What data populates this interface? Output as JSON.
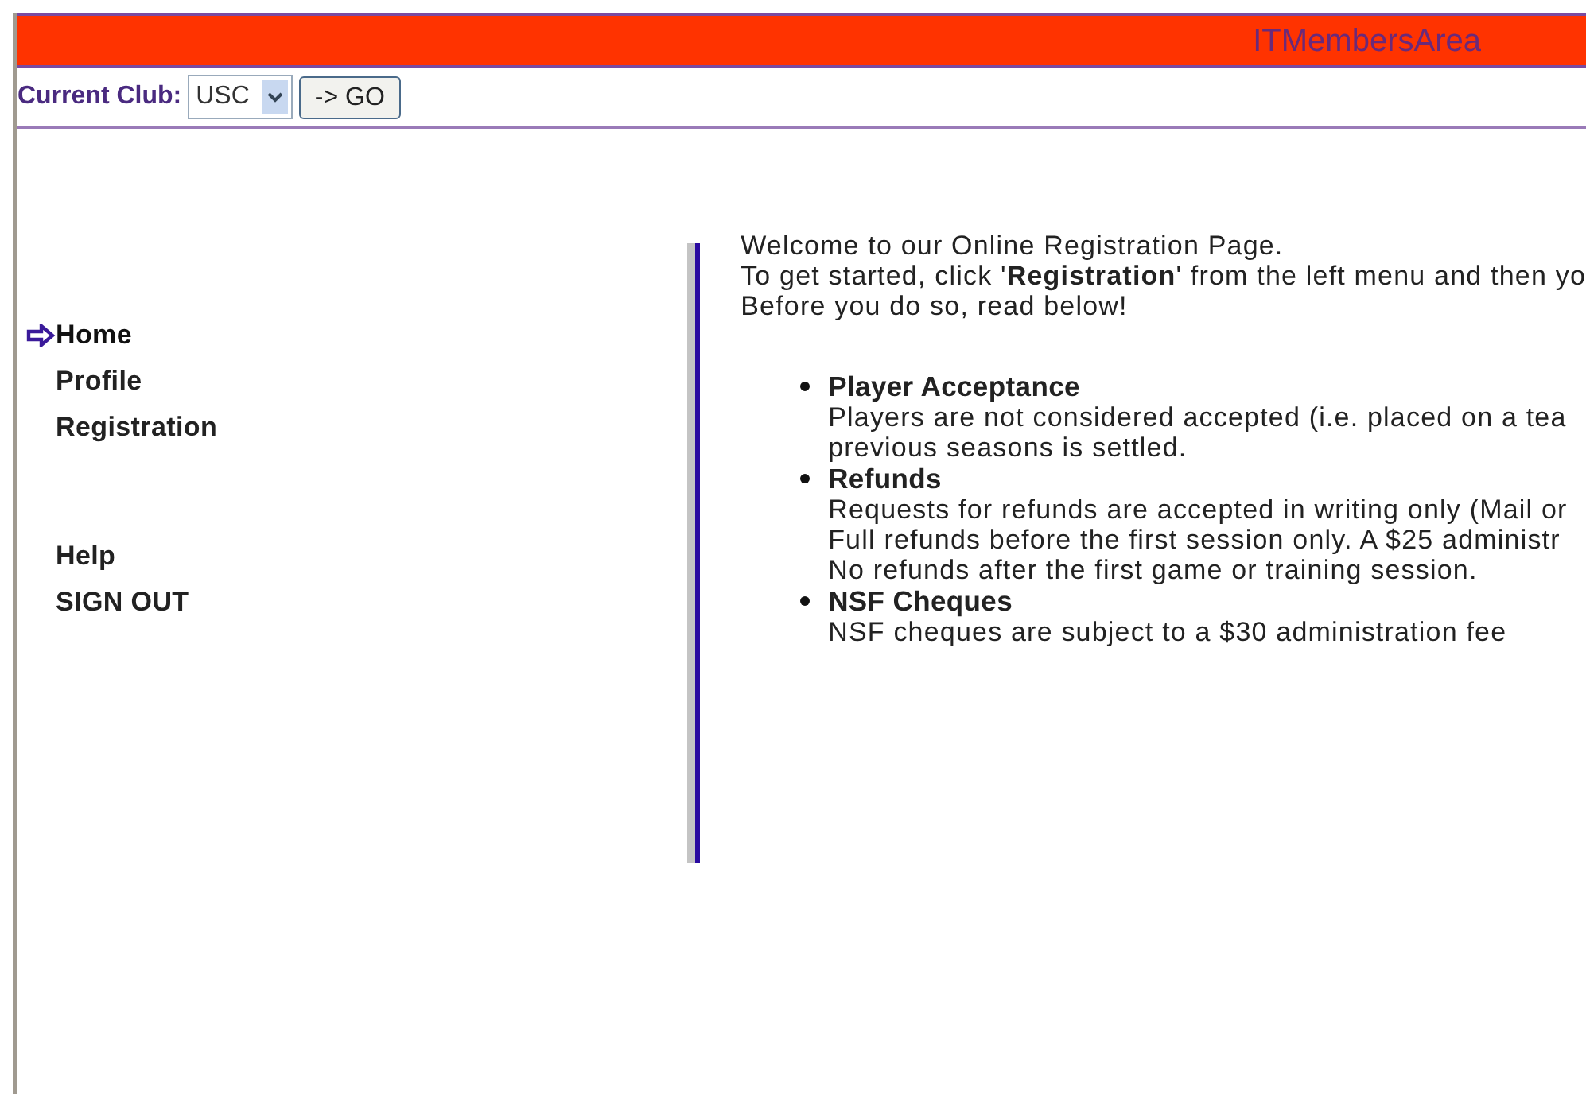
{
  "header": {
    "title": "ITMembersArea"
  },
  "club_bar": {
    "label": "Current Club:",
    "club": "USC",
    "go_button": "-> GO"
  },
  "menu": [
    {
      "label": "Home",
      "selected": true
    },
    {
      "label": "Profile",
      "selected": false
    },
    {
      "label": "Registration",
      "selected": false
    }
  ],
  "menu_bottom": [
    {
      "label": "Help",
      "selected": false
    },
    {
      "label": "SIGN OUT",
      "selected": false
    }
  ],
  "intro": [
    "Welcome to our Online Registration Page.",
    "To get started, click '**Registration**' from the left menu and then yo",
    "Before you do so, read below!"
  ],
  "notices": [
    {
      "title": "Player Acceptance",
      "lines": [
        "Players are not considered accepted (i.e. placed on a tea",
        "previous seasons is settled."
      ]
    },
    {
      "title": "Refunds",
      "lines": [
        "Requests for refunds are accepted in writing only (Mail or",
        "Full refunds before the first session only. A $25 administr",
        "No refunds after the first game or training session."
      ]
    },
    {
      "title": "NSF Cheques",
      "lines": [
        "NSF cheques are subject to a $30 administration fee"
      ]
    }
  ]
}
